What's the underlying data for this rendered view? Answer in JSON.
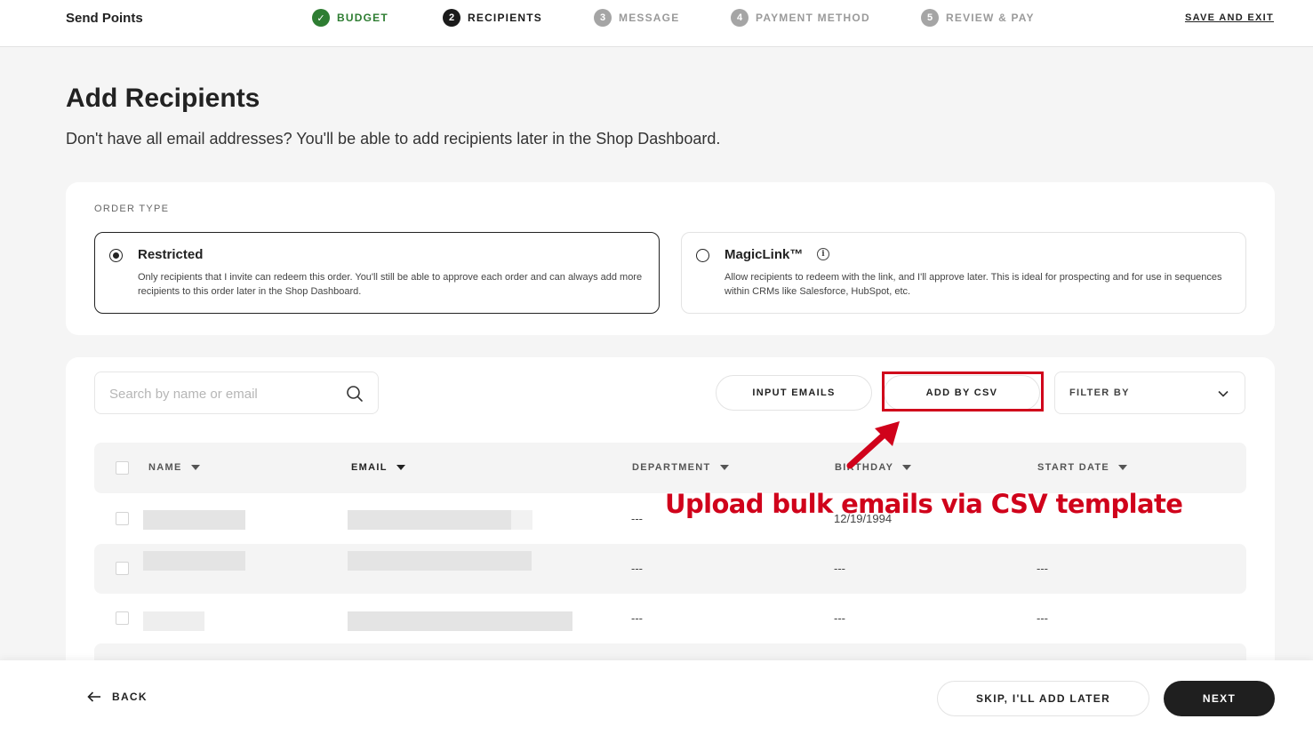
{
  "app": {
    "title": "Send Points"
  },
  "steps": [
    {
      "number": "✓",
      "label": "BUDGET",
      "state": "done"
    },
    {
      "number": "2",
      "label": "RECIPIENTS",
      "state": "active"
    },
    {
      "number": "3",
      "label": "MESSAGE",
      "state": "todo"
    },
    {
      "number": "4",
      "label": "PAYMENT METHOD",
      "state": "todo"
    },
    {
      "number": "5",
      "label": "REVIEW & PAY",
      "state": "todo"
    }
  ],
  "header": {
    "save_exit": "SAVE AND EXIT",
    "title": "Add Recipients",
    "subtitle": "Don't have all email addresses? You'll be able to add recipients later in the Shop Dashboard."
  },
  "order_type": {
    "label": "ORDER TYPE",
    "options": [
      {
        "title": "Restricted",
        "description": "Only recipients that I invite can redeem this order. You'll still be able to approve each order and can always add more recipients to this order later in the Shop Dashboard.",
        "selected": true
      },
      {
        "title": "MagicLink™",
        "description": "Allow recipients to redeem with the link, and I'll approve later. This is ideal for prospecting and for use in sequences within CRMs like Salesforce, HubSpot, etc.",
        "selected": false,
        "info_icon": "info-icon"
      }
    ]
  },
  "toolbar": {
    "search_placeholder": "Search by name or email",
    "input_emails": "INPUT EMAILS",
    "add_by_csv": "ADD BY CSV",
    "filter_by": "FILTER BY"
  },
  "table": {
    "columns": [
      "NAME",
      "EMAIL",
      "DEPARTMENT",
      "BIRTHDAY",
      "START DATE"
    ],
    "rows": [
      {
        "department": "---",
        "birthday": "12/19/1994",
        "start_date": ""
      },
      {
        "department": "---",
        "birthday": "---",
        "start_date": "---"
      },
      {
        "department": "---",
        "birthday": "---",
        "start_date": "---"
      }
    ]
  },
  "annotation": {
    "text": "Upload bulk emails via CSV template",
    "color": "#d0021b"
  },
  "footer": {
    "back": "BACK",
    "skip": "SKIP, I'LL ADD LATER",
    "next": "NEXT"
  },
  "colors": {
    "success": "#2e7d32",
    "primary_dark": "#1f1f1f",
    "annotation_red": "#d0021b"
  }
}
